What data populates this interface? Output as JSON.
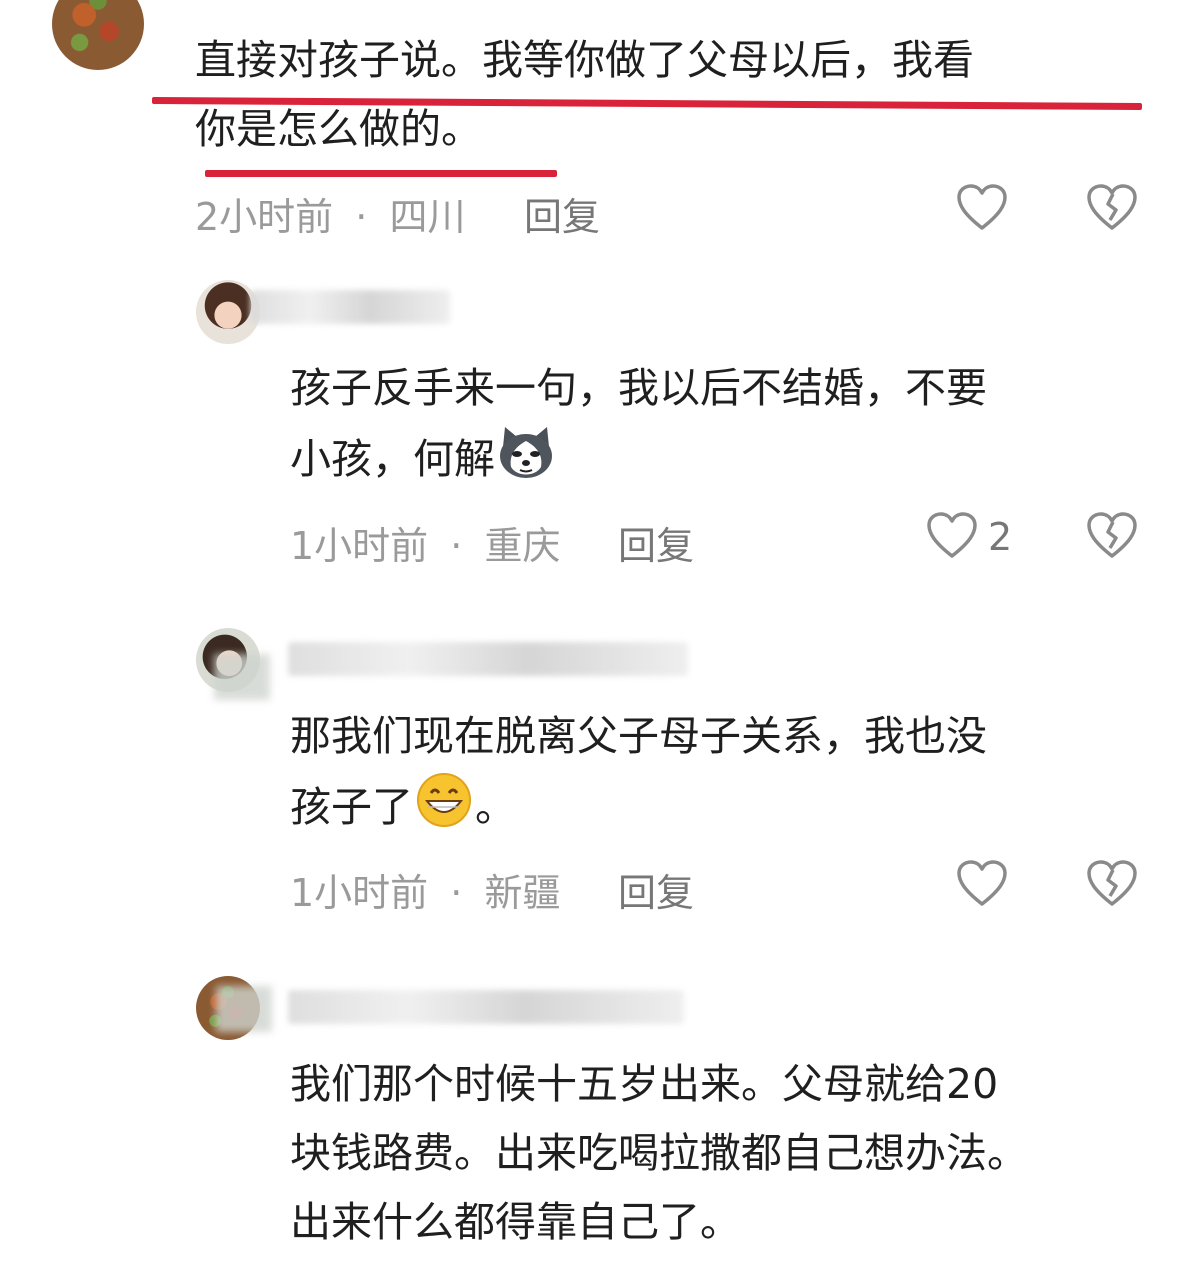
{
  "comments": [
    {
      "text_line1": "直接对孩子说。我等你做了父母以后，我看",
      "text_line2": "你是怎么做的。",
      "time": "2小时前",
      "location": "四川",
      "reply_label": "回复"
    },
    {
      "text_line1": "孩子反手来一句，我以后不结婚，不要",
      "text_line2": "小孩，何解",
      "emoji": "husky-dog-emoji",
      "time": "1小时前",
      "location": "重庆",
      "reply_label": "回复",
      "like_count": "2"
    },
    {
      "text_line1": "那我们现在脱离父子母子关系，我也没",
      "text_line2": "孩子了",
      "emoji": "grinning-face-emoji",
      "text_line2_end": "。",
      "time": "1小时前",
      "location": "新疆",
      "reply_label": "回复"
    },
    {
      "text_line1": "我们那个时候十五岁出来。父母就给20",
      "text_line2": "块钱路费。出来吃喝拉撒都自己想办法。",
      "text_line3": "出来什么都得靠自己了。"
    }
  ],
  "meta_separator": "·",
  "colors": {
    "annotation_red": "#d8233a",
    "meta_gray": "#9a9a9a",
    "text": "#1f1f1f"
  },
  "icons": [
    "heart-outline-icon",
    "broken-heart-icon"
  ]
}
